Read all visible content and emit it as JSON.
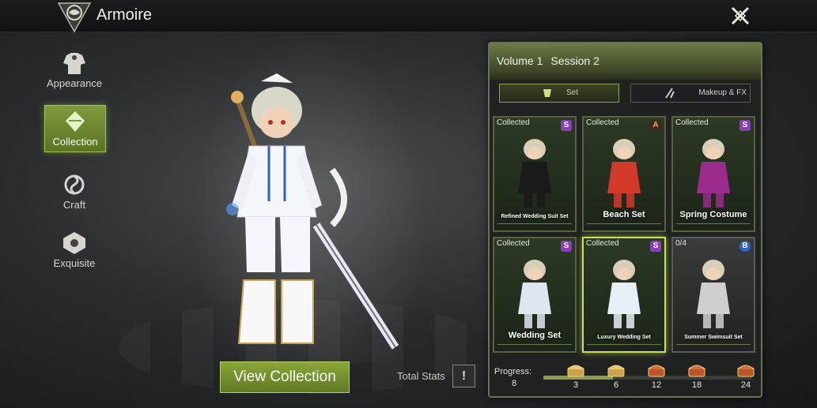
{
  "header": {
    "title": "Armoire"
  },
  "nav": [
    {
      "label": "Appearance",
      "icon": "appearance-icon",
      "active": false
    },
    {
      "label": "Collection",
      "icon": "collection-icon",
      "active": true
    },
    {
      "label": "Craft",
      "icon": "craft-icon",
      "active": false
    },
    {
      "label": "Exquisite",
      "icon": "exquisite-icon",
      "active": false
    }
  ],
  "view_button": "View Collection",
  "total_stats": {
    "label": "Total Stats",
    "button": "!"
  },
  "panel": {
    "volume": "Volume 1",
    "session": "Session 2",
    "tabs": [
      {
        "label": "Set"
      },
      {
        "label": "Makeup & FX"
      }
    ]
  },
  "cards": [
    {
      "status": "Collected",
      "grade": "S",
      "name": "Refined Wedding Suit Set",
      "outfit": "#1a1a1a"
    },
    {
      "status": "Collected",
      "grade": "A",
      "name": "Beach Set",
      "outfit": "#d23a2a"
    },
    {
      "status": "Collected",
      "grade": "S",
      "name": "Spring Costume",
      "outfit": "#9b2c8c"
    },
    {
      "status": "Collected",
      "grade": "S",
      "name": "Wedding Set",
      "outfit": "#dfe6ef"
    },
    {
      "status": "Collected",
      "grade": "S",
      "name": "Luxury Wedding Set",
      "outfit": "#e8eef6"
    },
    {
      "status": "0/4",
      "grade": "B",
      "name": "Summer Swimsuit Set",
      "outfit": "#cfcfcf"
    }
  ],
  "progress": {
    "label": "Progress:",
    "value": "8",
    "current": 8,
    "milestones": [
      "3",
      "6",
      "12",
      "18",
      "24"
    ]
  },
  "colors": {
    "accent": "#7f9a3b",
    "panel_border": "#6b7355"
  }
}
